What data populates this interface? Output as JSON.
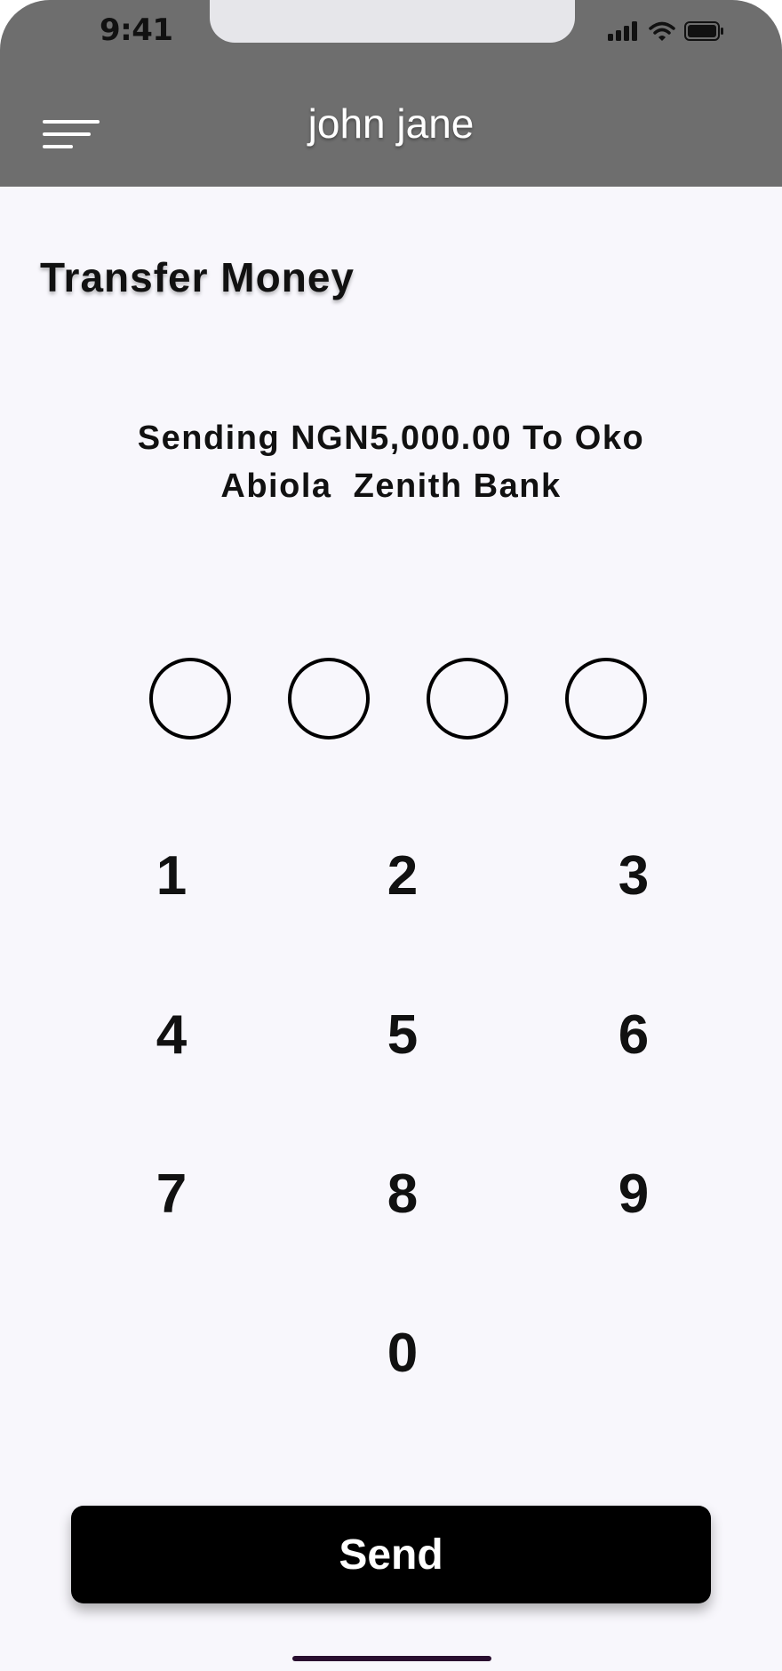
{
  "status_bar": {
    "time": "9:41",
    "icons": [
      "cellular-signal-icon",
      "wifi-icon",
      "battery-icon"
    ]
  },
  "header": {
    "menu_icon": "hamburger-menu-icon",
    "title": "john jane",
    "background": "#6e6e6e"
  },
  "page": {
    "title": "Transfer Money",
    "sending_line1": "Sending NGN5,000.00 To Oko",
    "sending_line2": "Abiola  Zenith Bank"
  },
  "pin": {
    "length": 4,
    "filled": 0
  },
  "keypad": {
    "keys": [
      "1",
      "2",
      "3",
      "4",
      "5",
      "6",
      "7",
      "8",
      "9",
      "0"
    ]
  },
  "actions": {
    "send_label": "Send"
  },
  "colors": {
    "page_background": "#f8f7fc",
    "button": "#000000",
    "home_indicator": "#2a0f30"
  }
}
